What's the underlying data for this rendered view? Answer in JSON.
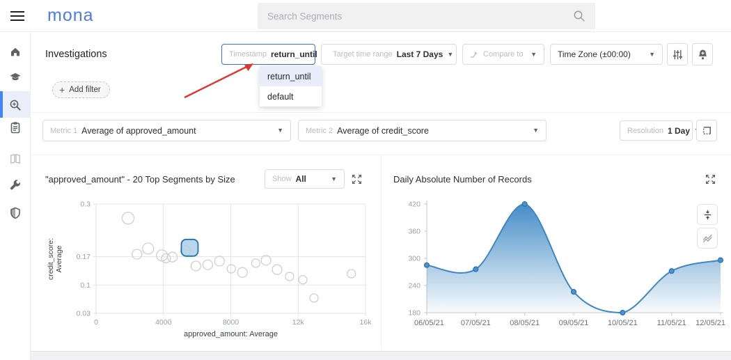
{
  "topbar": {
    "logo": "mona",
    "search_placeholder": "Search Segments"
  },
  "sidebar": {
    "items": [
      "home",
      "education",
      "investigate-search",
      "reports",
      "docs",
      "settings-tools",
      "security"
    ],
    "active": "investigate-search"
  },
  "header": {
    "title": "Investigations",
    "add_filter": "Add filter",
    "timestamp_label": "Timestamp",
    "timestamp_value": "return_until",
    "menu": [
      "return_until",
      "default"
    ],
    "target_label": "Target time range",
    "target_value": "Last 7 Days",
    "compare_label": "Compare to",
    "timezone_value": "Time Zone (±00:00)"
  },
  "metrics": {
    "metric1_label": "Metric 1",
    "metric1_value": "Average of approved_amount",
    "metric2_label": "Metric 2",
    "metric2_value": "Average of credit_score",
    "resolution_label": "Resolution",
    "resolution_value": "1 Day",
    "show_label": "Show",
    "show_value": "All"
  },
  "colors": {
    "accent_blue": "#3b6fd4",
    "logo_blue": "#4b7ce8",
    "line_blue": "#3c87c4",
    "bubble_stroke": "#cfcfcf",
    "highlight_fill": "#aecfe8",
    "highlight_stroke": "#1f72ad",
    "annotation_red": "#e0362c"
  },
  "chart_data": [
    {
      "type": "scatter",
      "title": "\"approved_amount\" - 20 Top Segments by Size",
      "xlabel": "approved_amount: Average",
      "ylabel_line1": "credit_score:",
      "ylabel_line2": "Average",
      "xlim": [
        0,
        16000
      ],
      "ylim": [
        0.03,
        0.3
      ],
      "xticks": [
        {
          "v": 0,
          "label": "0"
        },
        {
          "v": 4000,
          "label": "4000"
        },
        {
          "v": 8000,
          "label": "8000"
        },
        {
          "v": 12000,
          "label": "12k"
        },
        {
          "v": 16000,
          "label": "16k"
        }
      ],
      "yticks": [
        {
          "v": 0.3,
          "label": "0.3"
        },
        {
          "v": 0.17,
          "label": "0.17"
        },
        {
          "v": 0.1,
          "label": "0.1"
        },
        {
          "v": 0.03,
          "label": "0.03"
        }
      ],
      "grid": true,
      "points": [
        {
          "x": 1900,
          "y": 0.265,
          "r": 8.5
        },
        {
          "x": 2430,
          "y": 0.176,
          "r": 7
        },
        {
          "x": 3090,
          "y": 0.19,
          "r": 8
        },
        {
          "x": 3910,
          "y": 0.173,
          "r": 8
        },
        {
          "x": 4150,
          "y": 0.166,
          "r": 6.5
        },
        {
          "x": 4530,
          "y": 0.169,
          "r": 7
        },
        {
          "x": 5320,
          "y": 0.185,
          "r": 7
        },
        {
          "x": 5930,
          "y": 0.147,
          "r": 7
        },
        {
          "x": 6630,
          "y": 0.15,
          "r": 7
        },
        {
          "x": 7330,
          "y": 0.159,
          "r": 7
        },
        {
          "x": 8030,
          "y": 0.14,
          "r": 6
        },
        {
          "x": 8690,
          "y": 0.131,
          "r": 7
        },
        {
          "x": 9480,
          "y": 0.154,
          "r": 6
        },
        {
          "x": 10090,
          "y": 0.161,
          "r": 7
        },
        {
          "x": 10750,
          "y": 0.138,
          "r": 7
        },
        {
          "x": 11490,
          "y": 0.121,
          "r": 6
        },
        {
          "x": 12280,
          "y": 0.113,
          "r": 6
        },
        {
          "x": 12940,
          "y": 0.068,
          "r": 6
        },
        {
          "x": 15160,
          "y": 0.128,
          "r": 6
        }
      ],
      "highlighted_point": {
        "x": 5560,
        "y": 0.192
      }
    },
    {
      "type": "area",
      "title": "Daily Absolute Number of Records",
      "x": [
        "06/05/21",
        "07/05/21",
        "08/05/21",
        "09/05/21",
        "10/05/21",
        "11/05/21",
        "12/05/21"
      ],
      "values": [
        285,
        276,
        420,
        226,
        180,
        272,
        296
      ],
      "ylim": [
        180,
        420
      ],
      "yticks": [
        180,
        240,
        300,
        360,
        420
      ],
      "grid": false,
      "legend": "none"
    }
  ]
}
